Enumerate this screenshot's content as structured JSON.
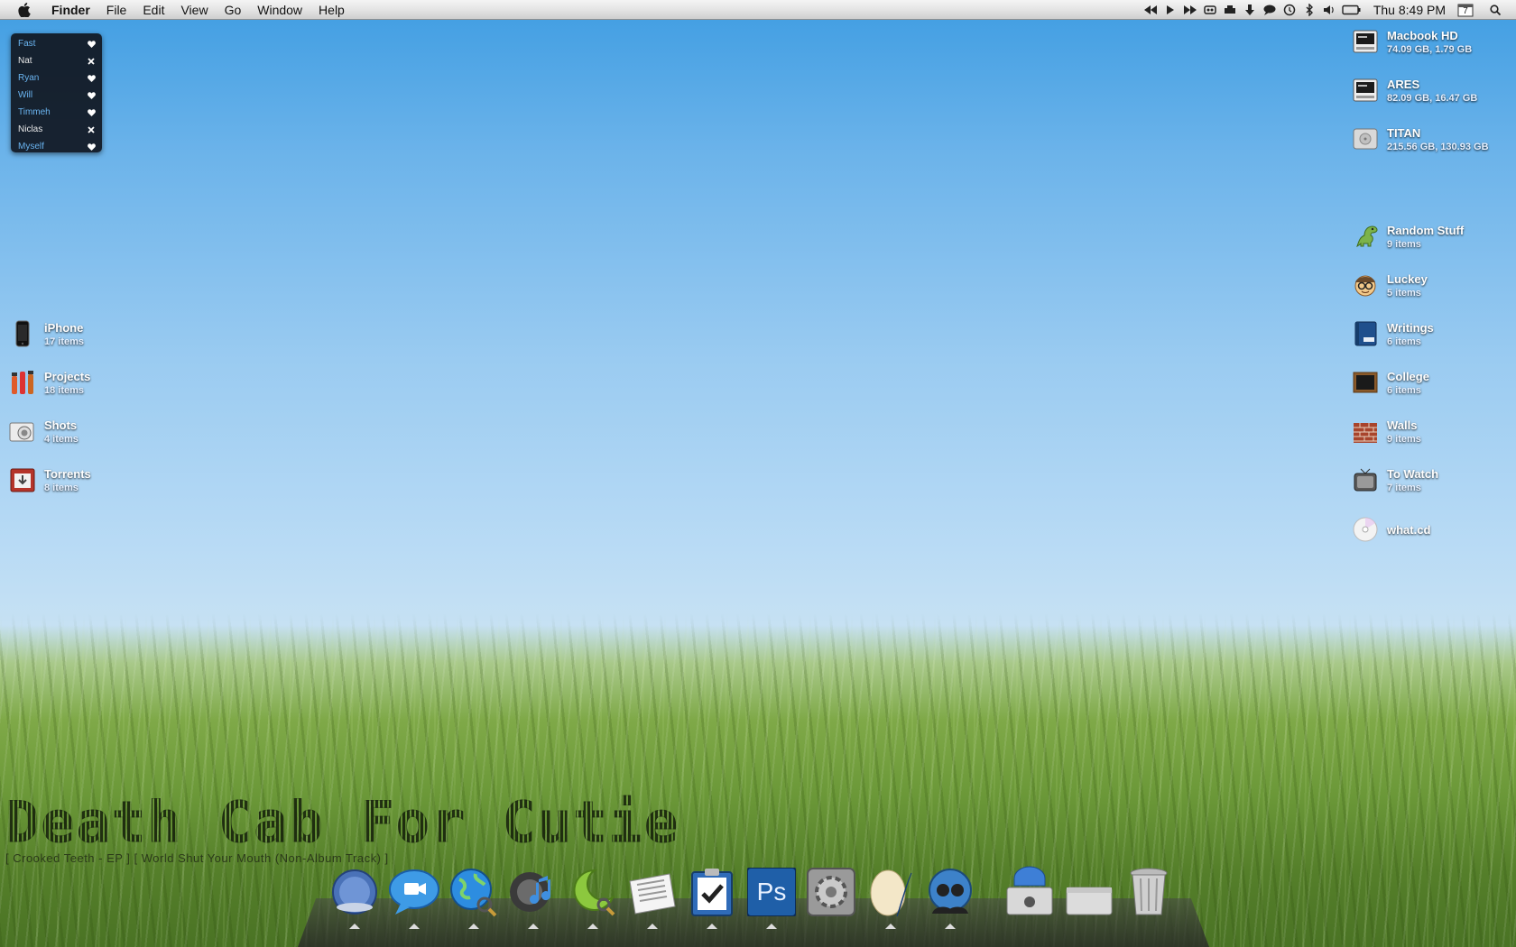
{
  "menubar": {
    "app_name": "Finder",
    "menus": [
      "File",
      "Edit",
      "View",
      "Go",
      "Window",
      "Help"
    ],
    "status_icons": [
      "rewind-icon",
      "play-icon",
      "fast-forward-icon",
      "control-icon",
      "printer-icon",
      "download-icon",
      "speech-bubble-icon",
      "time-machine-icon",
      "bluetooth-icon",
      "volume-icon",
      "battery-icon"
    ],
    "clock": "Thu 8:49 PM",
    "calendar_day": "7"
  },
  "contacts": [
    {
      "name": "Fast",
      "status": "online",
      "icon": "heart-icon"
    },
    {
      "name": "Nat",
      "status": "offline",
      "icon": "close-icon"
    },
    {
      "name": "Ryan",
      "status": "online",
      "icon": "heart-icon"
    },
    {
      "name": "Will",
      "status": "online",
      "icon": "heart-icon"
    },
    {
      "name": "Timmeh",
      "status": "online",
      "icon": "heart-icon"
    },
    {
      "name": "Niclas",
      "status": "offline",
      "icon": "close-icon"
    },
    {
      "name": "Myself",
      "status": "online",
      "icon": "heart-icon"
    }
  ],
  "drives": [
    {
      "name": "Macbook HD",
      "info": "74.09 GB, 1.79 GB"
    },
    {
      "name": "ARES",
      "info": "82.09 GB, 16.47 GB"
    },
    {
      "name": "TITAN",
      "info": "215.56 GB, 130.93 GB"
    }
  ],
  "right_folders": [
    {
      "name": "Random Stuff",
      "info": "9 items"
    },
    {
      "name": "Luckey",
      "info": "5 items"
    },
    {
      "name": "Writings",
      "info": "6 items"
    },
    {
      "name": "College",
      "info": "6 items"
    },
    {
      "name": "Walls",
      "info": "9 items"
    },
    {
      "name": "To Watch",
      "info": "7 items"
    },
    {
      "name": "what.cd",
      "info": ""
    }
  ],
  "left_folders": [
    {
      "name": "iPhone",
      "info": "17 items"
    },
    {
      "name": "Projects",
      "info": "18 items"
    },
    {
      "name": "Shots",
      "info": "4 items"
    },
    {
      "name": "Torrents",
      "info": "8 items"
    }
  ],
  "now_playing": {
    "artist": "Death Cab For Cutie",
    "track": "[ Crooked Teeth - EP ] [ World Shut Your Mouth (Non-Album Track) ]"
  },
  "dock": {
    "apps": [
      {
        "icon": "safari-like-compass-icon",
        "running": true
      },
      {
        "icon": "ichat-icon",
        "running": true
      },
      {
        "icon": "globe-search-icon",
        "running": true
      },
      {
        "icon": "itunes-icon",
        "running": true
      },
      {
        "icon": "moon-search-icon",
        "running": true
      },
      {
        "icon": "newspaper-icon",
        "running": true
      },
      {
        "icon": "clipboard-check-icon",
        "running": true
      },
      {
        "icon": "photoshop-icon",
        "label": "Ps",
        "running": true
      },
      {
        "icon": "system-preferences-icon",
        "running": false
      },
      {
        "icon": "egg-quill-icon",
        "running": true
      },
      {
        "icon": "world-people-icon",
        "running": true
      }
    ],
    "docs": [
      {
        "icon": "downloads-stack-icon"
      },
      {
        "icon": "documents-stack-icon"
      },
      {
        "icon": "trash-icon"
      }
    ]
  },
  "colors": {
    "online_contact": "#6ab4f0",
    "offline_contact": "#e9e9e9",
    "photoshop_blue": "#1f5fa8"
  }
}
